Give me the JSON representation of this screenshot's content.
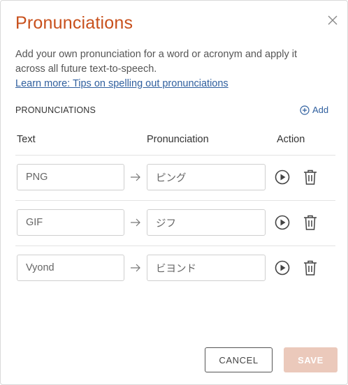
{
  "dialog": {
    "title": "Pronunciations",
    "description": "Add your own pronunciation for a word or acronym and apply it across all future text-to-speech.",
    "learn_more": "Learn more: Tips on spelling out pronunciations",
    "section_label": "PRONUNCIATIONS",
    "add_label": "Add"
  },
  "table": {
    "headers": {
      "text": "Text",
      "pronunciation": "Pronunciation",
      "action": "Action"
    },
    "rows": [
      {
        "text": "PNG",
        "pronunciation": "ピング"
      },
      {
        "text": "GIF",
        "pronunciation": "ジフ"
      },
      {
        "text": "Vyond",
        "pronunciation": "ビヨンド"
      }
    ]
  },
  "footer": {
    "cancel_label": "CANCEL",
    "save_label": "SAVE"
  },
  "icons": {
    "close": "close-icon",
    "add": "plus-circle-icon",
    "arrow": "arrow-right-icon",
    "play": "play-circle-icon",
    "delete": "trash-icon"
  },
  "colors": {
    "title": "#c8501c",
    "link": "#2f5f9e",
    "save_disabled": "#ebc9bb"
  }
}
